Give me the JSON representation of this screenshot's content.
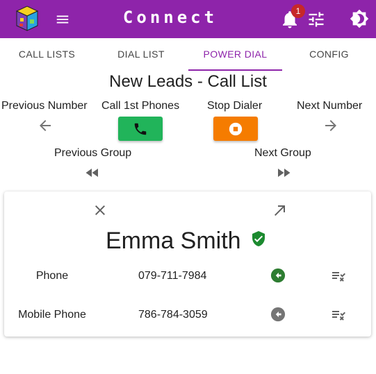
{
  "app": {
    "title": "Connect",
    "notification_count": "1"
  },
  "tabs": [
    {
      "label": "CALL LISTS",
      "active": false
    },
    {
      "label": "DIAL LIST",
      "active": false
    },
    {
      "label": "POWER DIAL",
      "active": true
    },
    {
      "label": "CONFIG",
      "active": false
    }
  ],
  "dialer": {
    "list_title": "New Leads - Call List",
    "previous_number": "Previous Number",
    "call_first": "Call 1st Phones",
    "stop_dialer": "Stop Dialer",
    "next_number": "Next Number",
    "previous_group": "Previous Group",
    "next_group": "Next Group"
  },
  "contact": {
    "name": "Emma Smith",
    "verified": true,
    "phones": [
      {
        "label": "Phone",
        "number": "079-711-7984",
        "status_color": "#2e7d32"
      },
      {
        "label": "Mobile Phone",
        "number": "786-784-3059",
        "status_color": "#757575"
      }
    ]
  },
  "colors": {
    "primary": "#8e24aa",
    "call_green": "#21b45a",
    "stop_orange": "#f57c00",
    "badge_red": "#c62828"
  },
  "icons": [
    "logo-icon",
    "menu-icon",
    "bell-icon",
    "tune-icon",
    "brightness-icon",
    "arrow-left-icon",
    "phone-icon",
    "stop-icon",
    "arrow-right-icon",
    "rewind-icon",
    "fast-forward-icon",
    "close-icon",
    "open-in-new-icon",
    "verified-shield-icon",
    "dial-status-icon",
    "checklist-icon"
  ]
}
